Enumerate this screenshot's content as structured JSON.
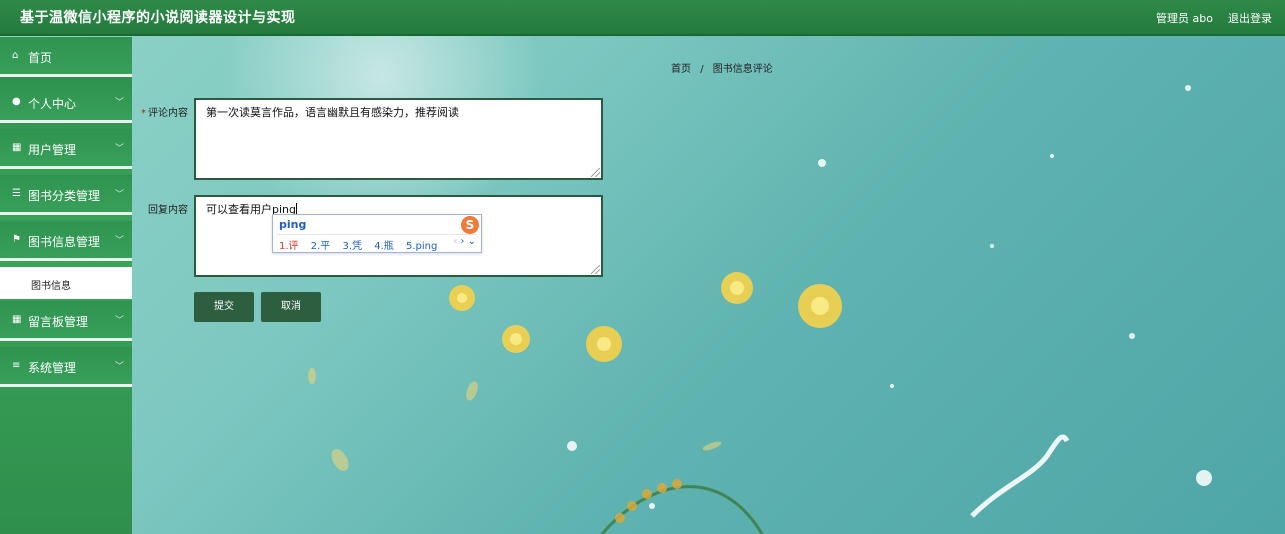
{
  "header": {
    "title": "基于温微信小程序的小说阅读器设计与实现",
    "user": "管理员 abo",
    "logout": "退出登录"
  },
  "sidebar": {
    "items": [
      {
        "label": "首页",
        "icon": "home-icon",
        "glyph": "⌂",
        "chevron": false
      },
      {
        "label": "个人中心",
        "icon": "user-icon",
        "glyph": "●",
        "chevron": true
      },
      {
        "label": "用户管理",
        "icon": "grid-icon",
        "glyph": "▦",
        "chevron": true
      },
      {
        "label": "图书分类管理",
        "icon": "list-icon",
        "glyph": "☰",
        "chevron": true
      },
      {
        "label": "图书信息管理",
        "icon": "flag-icon",
        "glyph": "⚑",
        "chevron": true
      },
      {
        "label": "留言板管理",
        "icon": "grid-icon",
        "glyph": "▦",
        "chevron": true
      },
      {
        "label": "系统管理",
        "icon": "sliders-icon",
        "glyph": "≡",
        "chevron": true
      }
    ],
    "subitem": "图书信息"
  },
  "breadcrumb": {
    "home": "首页",
    "separator": "/",
    "current": "图书信息评论"
  },
  "form": {
    "comment_label": "评论内容",
    "comment_value": "第一次读莫言作品，语言幽默且有感染力，推荐阅读",
    "reply_label": "回复内容",
    "reply_value": "可以查看用户ping",
    "submit": "提交",
    "cancel": "取消"
  },
  "ime": {
    "pinyin": "ping",
    "logo": "S",
    "candidates": [
      "1.评",
      "2.平",
      "3.凭",
      "4.瓶",
      "5.ping"
    ],
    "prev": "‹",
    "next": "›"
  },
  "colors": {
    "header": "#2f8a49",
    "sidebar": "#37a05a",
    "button": "#2d5e40",
    "ime_accent": "#1f5fbf"
  }
}
